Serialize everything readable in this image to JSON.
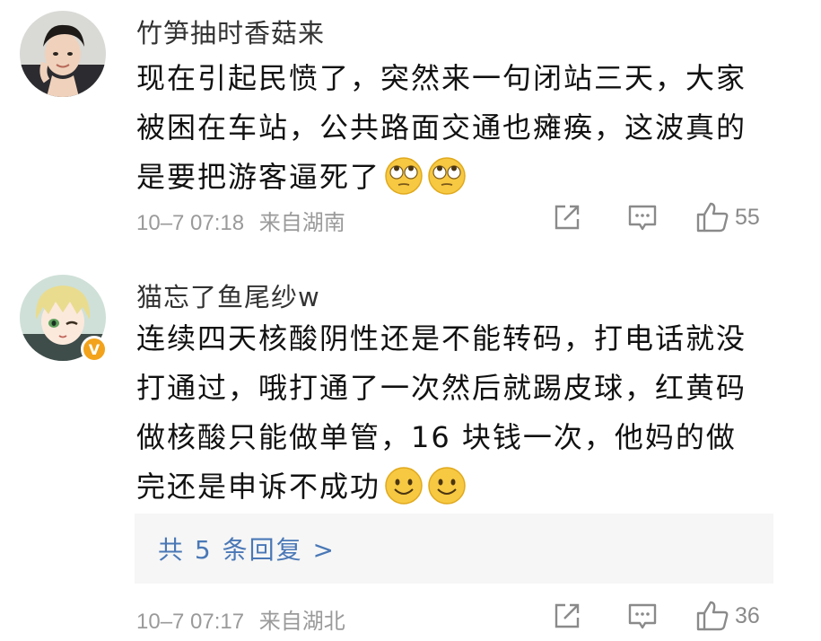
{
  "comments": [
    {
      "username": "竹笋抽时香菇来",
      "content_lines": [
        "现在引起民愤了，突然来一句闭站三天，大家",
        "被困在车站，公共路面交通也瘫痪，这波真的",
        "是要把游客逼死了"
      ],
      "emoji": [
        "rolling-eyes-emoji",
        "rolling-eyes-emoji"
      ],
      "time": "10–7 07:18",
      "location": "来自湖南",
      "likes": "55",
      "verified": false
    },
    {
      "username": "猫忘了鱼尾纱w",
      "content_lines": [
        "连续四天核酸阴性还是不能转码，打电话就没",
        "打通过，哦打通了一次然后就踢皮球，红黄码",
        "做核酸只能做单管，16 块钱一次，他妈的做",
        "完还是申诉不成功"
      ],
      "emoji": [
        "smile-emoji",
        "smile-emoji"
      ],
      "time": "10–7 07:17",
      "location": "来自湖北",
      "likes": "36",
      "verified": true,
      "verified_badge": "V",
      "replies_label": "共 5 条回复 >"
    }
  ],
  "colors": {
    "link": "#4a78b6",
    "meta": "#9a9a9a",
    "badge": "#f2a31b",
    "emoji_face": "#f7c842"
  }
}
